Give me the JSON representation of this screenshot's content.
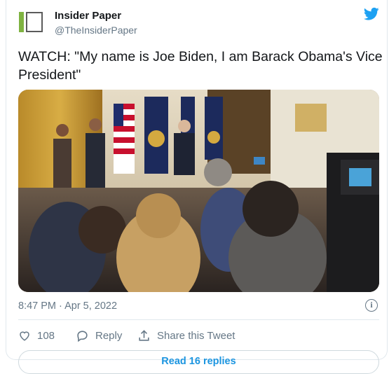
{
  "author": {
    "logo_text": "IP",
    "name": "Insider Paper",
    "handle": "@TheInsiderPaper"
  },
  "tweet": {
    "text": "WATCH: \"My name is Joe Biden, I am Barack Obama's Vice President\""
  },
  "media": {
    "type": "video",
    "icon": "video-thumbnail"
  },
  "meta": {
    "timestamp": "8:47 PM · Apr 5, 2022"
  },
  "actions": {
    "like_count": "108",
    "reply_label": "Reply",
    "share_label": "Share this Tweet"
  },
  "footer": {
    "read_replies_label": "Read 16 replies"
  },
  "colors": {
    "twitter_blue": "#1da1f2",
    "logo_green": "#7fb341",
    "text_primary": "#14171a",
    "text_secondary": "#657786",
    "border": "#e1e8ed"
  }
}
